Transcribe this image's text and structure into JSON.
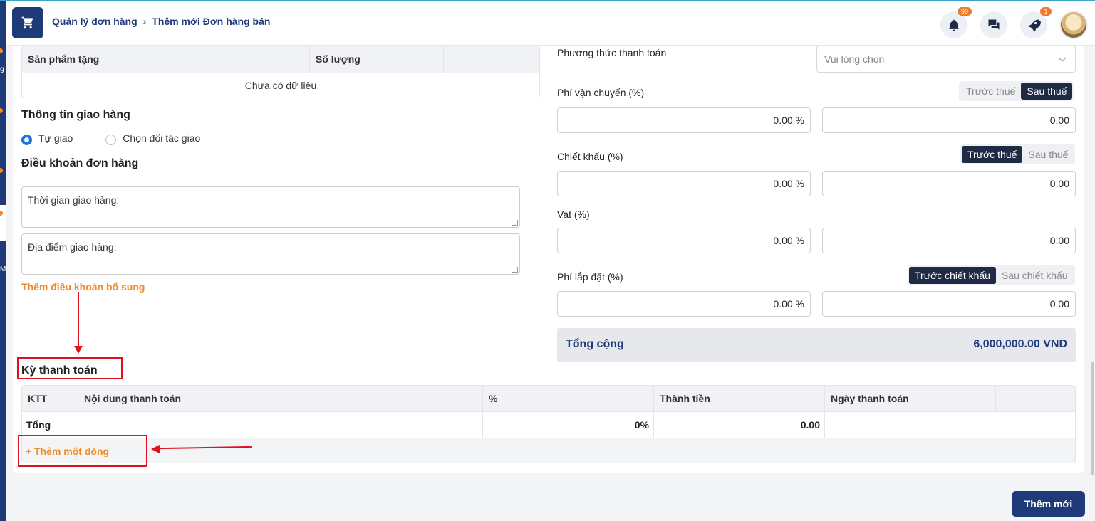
{
  "header": {
    "breadcrumb": [
      "Quản lý đơn hàng",
      "Thêm mới Đơn hàng bán"
    ],
    "notifications_badge": "99",
    "rocket_badge": "1",
    "icons": [
      "cart-icon",
      "bell-icon",
      "chat-icon",
      "rocket-icon",
      "avatar"
    ]
  },
  "sidebar_fragments": [
    "g",
    "M"
  ],
  "gift_table": {
    "columns": [
      "Sản phẩm tặng",
      "Số lượng",
      ""
    ],
    "empty_text": "Chưa có dữ liệu"
  },
  "delivery": {
    "title": "Thông tin giao hàng",
    "options": [
      "Tự giao",
      "Chọn đối tác giao"
    ],
    "selected": "Tự giao"
  },
  "terms": {
    "title": "Điều khoản đơn hàng",
    "delivery_time": "Thời gian giao hàng:",
    "delivery_place": "Địa điểm giao hàng:",
    "add_link": "Thêm điều khoản bổ sung"
  },
  "payment_terms": {
    "title": "Kỳ thanh toán",
    "columns": [
      "KTT",
      "Nội dung thanh toán",
      "%",
      "Thành tiền",
      "Ngày thanh toán",
      ""
    ],
    "total_row": {
      "label": "Tổng",
      "percent": "0%",
      "amount": "0.00"
    },
    "add_row": "+ Thêm một dòng"
  },
  "summary": {
    "payment_method_label": "Phương thức thanh toán",
    "payment_method_placeholder": "Vui lòng chọn",
    "shipping": {
      "label": "Phí vận chuyển (%)",
      "toggle": [
        "Trước thuế",
        "Sau thuế"
      ],
      "active": "Sau thuế",
      "percent": "0.00 %",
      "amount": "0.00"
    },
    "discount": {
      "label": "Chiết khấu (%)",
      "toggle": [
        "Trước thuế",
        "Sau thuế"
      ],
      "active": "Trước thuế",
      "percent": "0.00 %",
      "amount": "0.00"
    },
    "vat": {
      "label": "Vat (%)",
      "percent": "0.00 %",
      "amount": "0.00"
    },
    "install": {
      "label": "Phí lắp đặt (%)",
      "toggle": [
        "Trước chiết khấu",
        "Sau chiết khấu"
      ],
      "active": "Trước chiết khấu",
      "percent": "0.00 %",
      "amount": "0.00"
    },
    "total_label": "Tổng cộng",
    "total_value": "6,000,000.00 VND"
  },
  "actions": {
    "submit": "Thêm mới"
  },
  "colors": {
    "primary": "#1f3a78",
    "accent": "#f08a24",
    "annotation": "#e0101e"
  }
}
